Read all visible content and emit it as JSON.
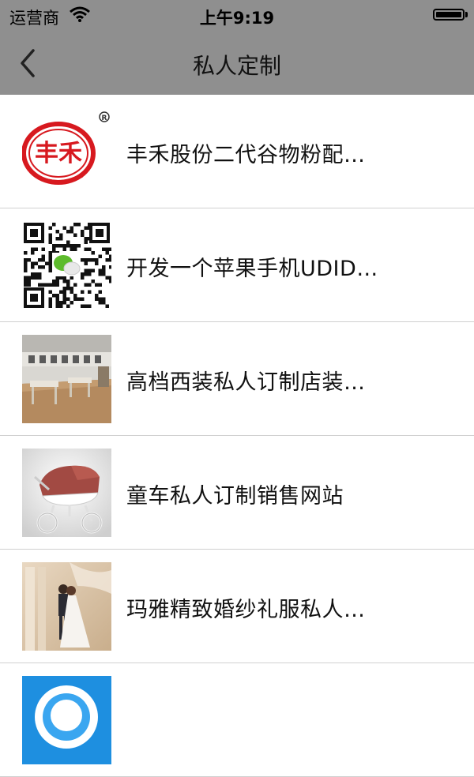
{
  "status_bar": {
    "carrier": "运营商",
    "time": "上午9:19"
  },
  "nav": {
    "title": "私人定制",
    "back_icon": "chevron-left-icon"
  },
  "items": [
    {
      "title": "丰禾股份二代谷物粉配…",
      "thumb": "fenghe-logo-image",
      "logo_text": "丰禾"
    },
    {
      "title": "开发一个苹果手机UDID…",
      "thumb": "qr-code-image"
    },
    {
      "title": "高档西装私人订制店装…",
      "thumb": "store-interior-image"
    },
    {
      "title": "童车私人订制销售网站",
      "thumb": "baby-stroller-image"
    },
    {
      "title": "玛雅精致婚纱礼服私人…",
      "thumb": "wedding-photo-image"
    },
    {
      "title": "",
      "thumb": "mascot-image"
    }
  ],
  "colors": {
    "nav_background": "#8f8f8f",
    "logo_red": "#d7191f"
  }
}
